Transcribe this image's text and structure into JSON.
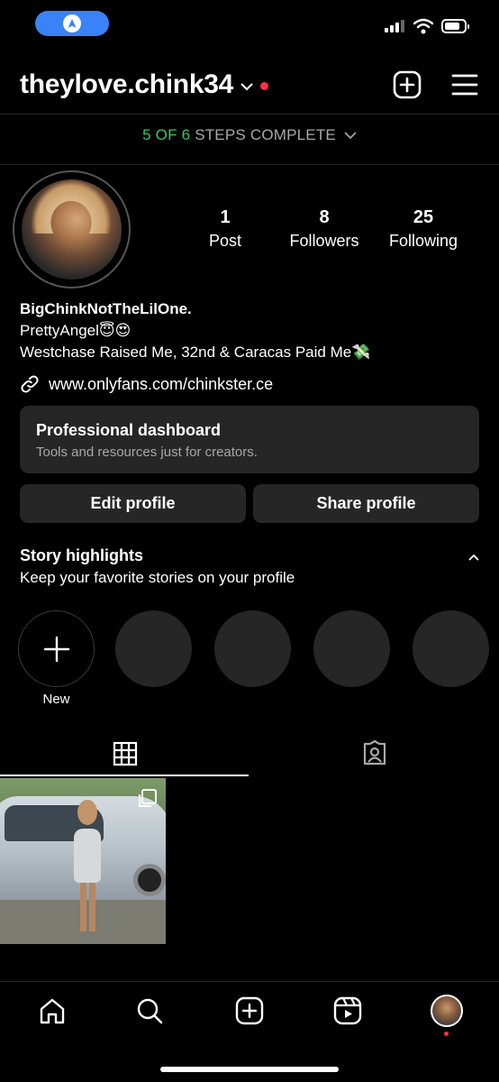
{
  "header": {
    "username": "theylove.chink34"
  },
  "steps": {
    "progress": "5 OF 6",
    "label": "STEPS COMPLETE",
    "completed": 5,
    "total": 6
  },
  "stats": [
    {
      "value": "1",
      "label": "Post"
    },
    {
      "value": "8",
      "label": "Followers"
    },
    {
      "value": "25",
      "label": "Following"
    }
  ],
  "bio": {
    "name": "BigChinkNotTheLilOne.",
    "line1": "PrettyAngel😇😍",
    "line2": "Westchase Raised Me, 32nd & Caracas Paid Me💸",
    "link": "www.onlyfans.com/chinkster.ce"
  },
  "dashboard": {
    "title": "Professional dashboard",
    "subtitle": "Tools and resources just for creators."
  },
  "buttons": {
    "edit": "Edit profile",
    "share": "Share profile"
  },
  "highlights": {
    "title": "Story highlights",
    "subtitle": "Keep your favorite stories on your profile",
    "new_label": "New"
  },
  "colors": {
    "accent_blue": "#3a82f7",
    "progress_green": "#36c95a",
    "notification_red": "#ff3040",
    "surface": "#262626"
  },
  "icons": {
    "status": [
      "navigation-icon",
      "signal-icon",
      "wifi-icon",
      "battery-icon"
    ],
    "header": [
      "create-icon",
      "menu-icon"
    ],
    "tabs": [
      "grid-icon",
      "tagged-icon"
    ],
    "bottom_nav": [
      "home-icon",
      "search-icon",
      "create-icon",
      "reels-icon",
      "profile-avatar"
    ]
  }
}
